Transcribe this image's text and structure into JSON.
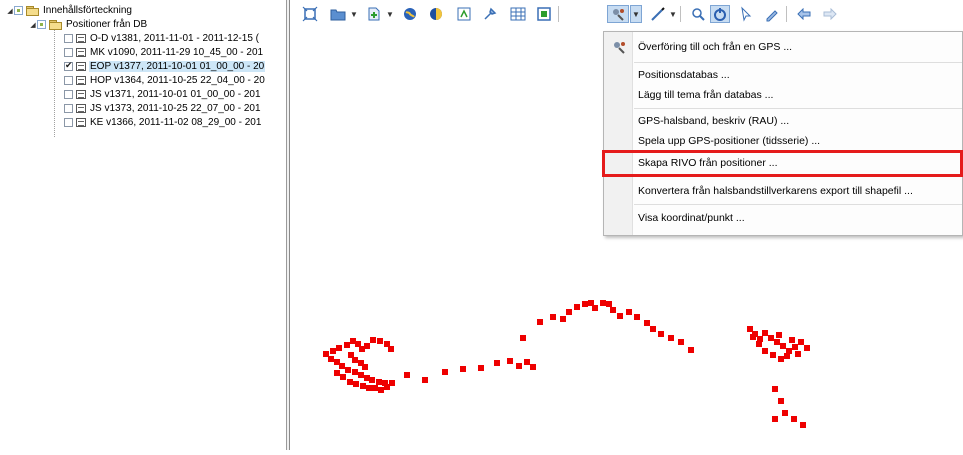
{
  "toc": {
    "root_label": "Innehållsförteckning",
    "group_label": "Positioner från DB",
    "layers": [
      {
        "label": "O-D v1381, 2011-11-01 - 2011-12-15 (",
        "checked": false,
        "selected": false
      },
      {
        "label": "MK v1090, 2011-11-29 10_45_00 - 201",
        "checked": false,
        "selected": false
      },
      {
        "label": "EOP v1377, 2011-10-01 01_00_00 - 20",
        "checked": true,
        "selected": true
      },
      {
        "label": "HOP v1364, 2011-10-25 22_04_00 - 20",
        "checked": false,
        "selected": false
      },
      {
        "label": "JS v1371, 2011-10-01 01_00_00 - 201",
        "checked": false,
        "selected": false
      },
      {
        "label": "JS v1373, 2011-10-25 22_07_00 - 201",
        "checked": false,
        "selected": false
      },
      {
        "label": "KE v1366, 2011-11-02 08_29_00 - 201",
        "checked": false,
        "selected": false
      }
    ]
  },
  "toolbar": {
    "icons": [
      "full-extent-icon",
      "open-icon",
      "add-data-icon",
      "globe-icon",
      "layer-icon",
      "identify-icon",
      "tool-icon",
      "table-icon",
      "layout-icon",
      "gps-tools-icon",
      "line-tool-icon",
      "zoom-icon",
      "select-icon",
      "pointer-icon",
      "edit-icon",
      "back-icon",
      "forward-icon"
    ]
  },
  "menu": {
    "items": [
      {
        "label": "Överföring till och från en GPS ...",
        "icon": "gps-icon"
      },
      {
        "label": "Positionsdatabas ..."
      },
      {
        "label": "Lägg till tema från databas ..."
      },
      {
        "label": "GPS-halsband, beskriv (RAU) ..."
      },
      {
        "label": "Spela upp GPS-positioner (tidsserie) ..."
      },
      {
        "label": "Skapa RIVO från positioner ..."
      },
      {
        "label": "Konvertera från halsbandstillverkarens export till shapefil ..."
      },
      {
        "label": "Visa koordinat/punkt ..."
      }
    ]
  },
  "colors": {
    "points": "#ee0000",
    "highlight": "#e51b1b"
  }
}
